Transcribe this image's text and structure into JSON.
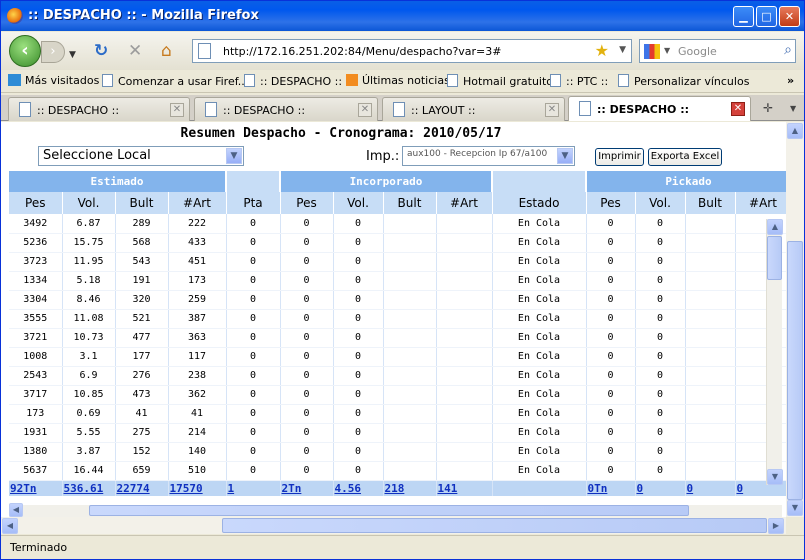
{
  "window": {
    "title": ":: DESPACHO :: - Mozilla Firefox"
  },
  "nav": {
    "url": "http://172.16.251.202:84/Menu/despacho?var=3#",
    "search_placeholder": "Google"
  },
  "bookmarks": [
    {
      "label": "Más visitados"
    },
    {
      "label": "Comenzar a usar Firef..."
    },
    {
      "label": ":: DESPACHO ::"
    },
    {
      "label": "Últimas noticias"
    },
    {
      "label": "Hotmail gratuito"
    },
    {
      "label": ":: PTC ::"
    },
    {
      "label": "Personalizar vínculos"
    }
  ],
  "tabs": [
    {
      "label": ":: DESPACHO ::"
    },
    {
      "label": ":: DESPACHO ::"
    },
    {
      "label": ":: LAYOUT ::"
    },
    {
      "label": ":: DESPACHO ::",
      "active": true
    }
  ],
  "page": {
    "title": "Resumen Despacho - Cronograma: 2010/05/17",
    "local_select": "Seleccione Local",
    "imp_label": "Imp.:",
    "imp_select": "aux100 - Recepcion Ip 67/a100",
    "print_button": "Imprimir",
    "export_button": "Exporta Excel"
  },
  "table": {
    "groups": [
      "Estimado",
      "",
      "Incorporado",
      "",
      "Pickado"
    ],
    "columns": [
      "Pes",
      "Vol.",
      "Bult",
      "#Art",
      "Pta",
      "Pes",
      "Vol.",
      "Bult",
      "#Art",
      "Estado",
      "Pes",
      "Vol.",
      "Bult",
      "#Art"
    ],
    "rows": [
      [
        "3492",
        "6.87",
        "289",
        "222",
        "0",
        "0",
        "0",
        "",
        "",
        "En Cola",
        "0",
        "0",
        "",
        ""
      ],
      [
        "5236",
        "15.75",
        "568",
        "433",
        "0",
        "0",
        "0",
        "",
        "",
        "En Cola",
        "0",
        "0",
        "",
        ""
      ],
      [
        "3723",
        "11.95",
        "543",
        "451",
        "0",
        "0",
        "0",
        "",
        "",
        "En Cola",
        "0",
        "0",
        "",
        ""
      ],
      [
        "1334",
        "5.18",
        "191",
        "173",
        "0",
        "0",
        "0",
        "",
        "",
        "En Cola",
        "0",
        "0",
        "",
        ""
      ],
      [
        "3304",
        "8.46",
        "320",
        "259",
        "0",
        "0",
        "0",
        "",
        "",
        "En Cola",
        "0",
        "0",
        "",
        ""
      ],
      [
        "3555",
        "11.08",
        "521",
        "387",
        "0",
        "0",
        "0",
        "",
        "",
        "En Cola",
        "0",
        "0",
        "",
        ""
      ],
      [
        "3721",
        "10.73",
        "477",
        "363",
        "0",
        "0",
        "0",
        "",
        "",
        "En Cola",
        "0",
        "0",
        "",
        ""
      ],
      [
        "1008",
        "3.1",
        "177",
        "117",
        "0",
        "0",
        "0",
        "",
        "",
        "En Cola",
        "0",
        "0",
        "",
        ""
      ],
      [
        "2543",
        "6.9",
        "276",
        "238",
        "0",
        "0",
        "0",
        "",
        "",
        "En Cola",
        "0",
        "0",
        "",
        ""
      ],
      [
        "3717",
        "10.85",
        "473",
        "362",
        "0",
        "0",
        "0",
        "",
        "",
        "En Cola",
        "0",
        "0",
        "",
        ""
      ],
      [
        "173",
        "0.69",
        "41",
        "41",
        "0",
        "0",
        "0",
        "",
        "",
        "En Cola",
        "0",
        "0",
        "",
        ""
      ],
      [
        "1931",
        "5.55",
        "275",
        "214",
        "0",
        "0",
        "0",
        "",
        "",
        "En Cola",
        "0",
        "0",
        "",
        ""
      ],
      [
        "1380",
        "3.87",
        "152",
        "140",
        "0",
        "0",
        "0",
        "",
        "",
        "En Cola",
        "0",
        "0",
        "",
        ""
      ],
      [
        "5637",
        "16.44",
        "659",
        "510",
        "0",
        "0",
        "0",
        "",
        "",
        "En Cola",
        "0",
        "0",
        "",
        ""
      ]
    ],
    "totals": [
      "92Tn",
      "536.61",
      "22774",
      "17570",
      "1",
      "2Tn",
      "4.56",
      "218",
      "141",
      "",
      "0Tn",
      "0",
      "0",
      "0"
    ]
  },
  "status": {
    "text": "Terminado"
  }
}
